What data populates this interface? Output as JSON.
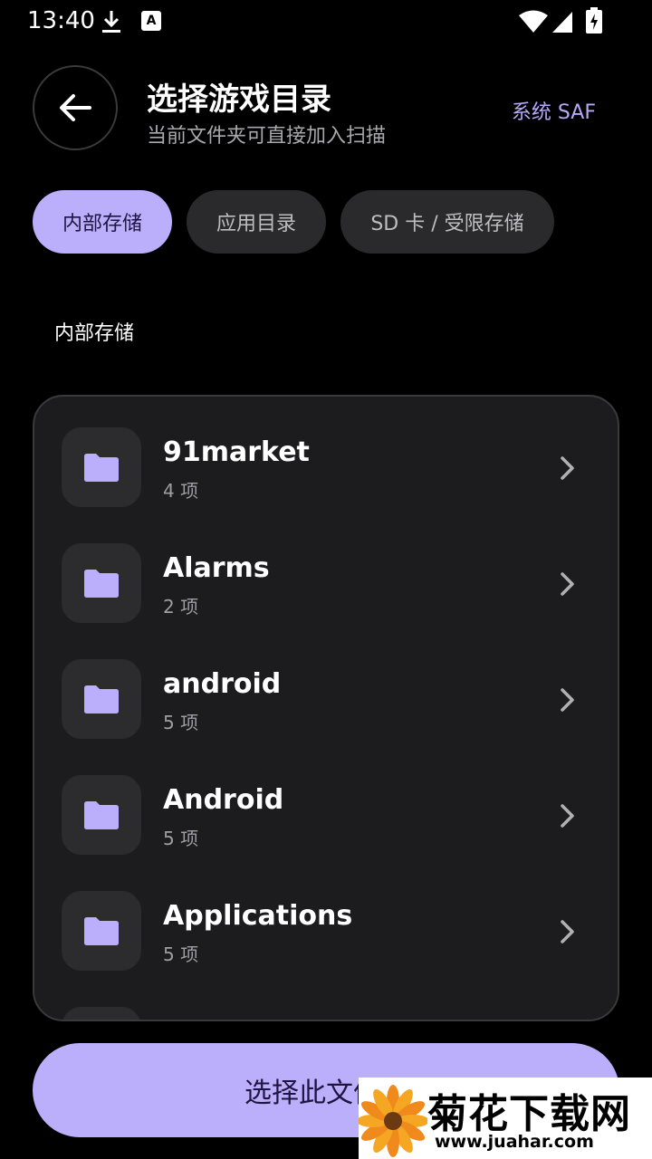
{
  "status_bar": {
    "time": "13:40",
    "badge_letter": "A"
  },
  "header": {
    "title": "选择游戏目录",
    "subtitle": "当前文件夹可直接加入扫描",
    "saf_label": "系统 SAF"
  },
  "tabs": [
    {
      "label": "内部存储",
      "active": true
    },
    {
      "label": "应用目录",
      "active": false
    },
    {
      "label": "SD 卡 / 受限存储",
      "active": false
    }
  ],
  "section_label": "内部存储",
  "folders": [
    {
      "name": "91market",
      "count": "4 项"
    },
    {
      "name": "Alarms",
      "count": "2 项"
    },
    {
      "name": "android",
      "count": "5 项"
    },
    {
      "name": "Android",
      "count": "5 项"
    },
    {
      "name": "Applications",
      "count": "5 项"
    }
  ],
  "primary_button": {
    "label": "选择此文件夹"
  },
  "watermark": {
    "title": "菊花下载网",
    "url": "www.juahar.com"
  },
  "colors": {
    "accent": "#bbaefa",
    "accent_text": "#b7a9f7",
    "background": "#000000",
    "card": "#1c1c1e"
  }
}
